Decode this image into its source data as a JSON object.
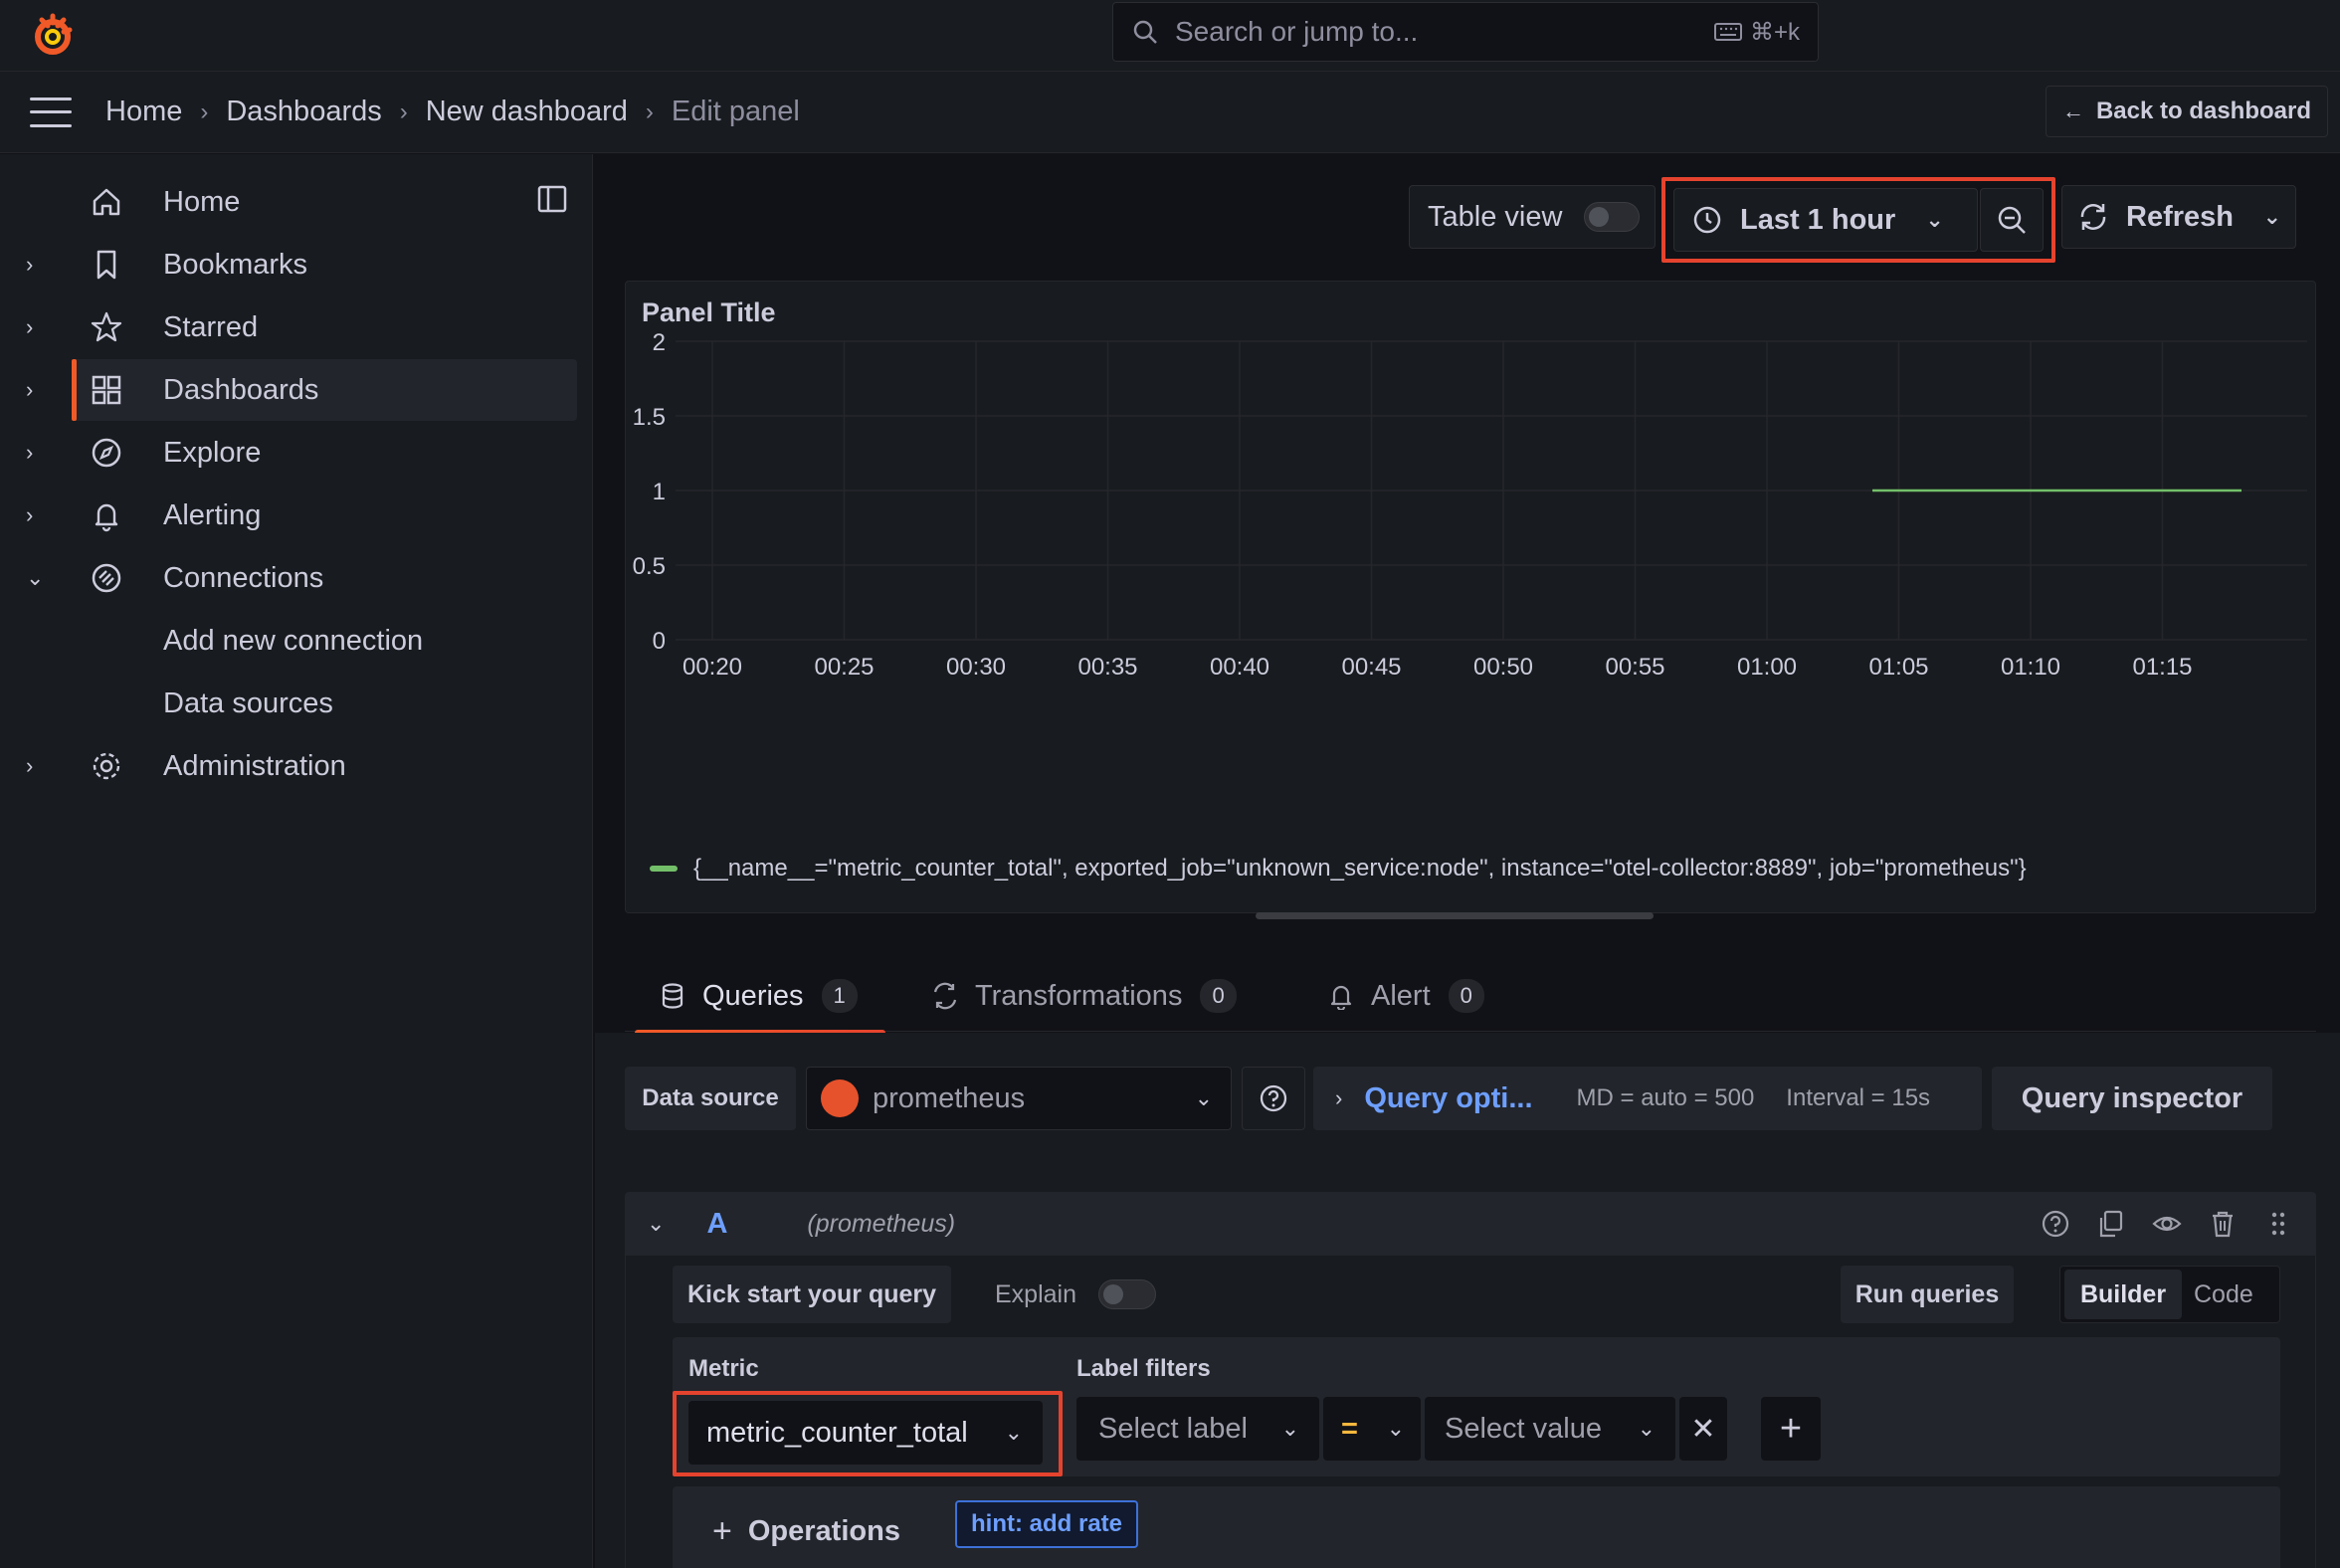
{
  "search": {
    "placeholder": "Search or jump to...",
    "shortcut": "⌘+k"
  },
  "breadcrumb": [
    "Home",
    "Dashboards",
    "New dashboard",
    "Edit panel"
  ],
  "back_label": "Back to dashboard",
  "sidebar": {
    "items": [
      {
        "label": "Home",
        "icon": "home-icon"
      },
      {
        "label": "Bookmarks",
        "icon": "bookmark-icon"
      },
      {
        "label": "Starred",
        "icon": "star-icon"
      },
      {
        "label": "Dashboards",
        "icon": "apps-icon",
        "active": true
      },
      {
        "label": "Explore",
        "icon": "compass-icon"
      },
      {
        "label": "Alerting",
        "icon": "bell-icon"
      },
      {
        "label": "Connections",
        "icon": "connections-icon",
        "expanded": true
      },
      {
        "label": "Add new connection"
      },
      {
        "label": "Data sources"
      },
      {
        "label": "Administration",
        "icon": "gear-icon"
      }
    ]
  },
  "toolbar": {
    "table_view": "Table view",
    "time_range": "Last 1 hour",
    "refresh": "Refresh"
  },
  "panel": {
    "title": "Panel Title"
  },
  "chart_data": {
    "type": "line",
    "title": "Panel Title",
    "x_ticks": [
      "00:20",
      "00:25",
      "00:30",
      "00:35",
      "00:40",
      "00:45",
      "00:50",
      "00:55",
      "01:00",
      "01:05",
      "01:10",
      "01:15"
    ],
    "y_ticks": [
      "0",
      "0.5",
      "1",
      "1.5",
      "2"
    ],
    "ylim": [
      0,
      2
    ],
    "series": [
      {
        "name": "{__name__=\"metric_counter_total\", exported_job=\"unknown_service:node\", instance=\"otel-collector:8889\", job=\"prometheus\"}",
        "color": "#73bf69",
        "x_start": "01:04",
        "x_end": "01:18",
        "value": 1
      }
    ],
    "grid": true,
    "legend": "bottom-left"
  },
  "tabs": [
    {
      "label": "Queries",
      "count": "1"
    },
    {
      "label": "Transformations",
      "count": "0"
    },
    {
      "label": "Alert",
      "count": "0"
    }
  ],
  "query_toolbar": {
    "data_source_label": "Data source",
    "data_source": "prometheus",
    "query_options": "Query opti...",
    "md": "MD = auto = 500",
    "interval": "Interval = 15s",
    "inspector": "Query inspector"
  },
  "query": {
    "ref": "A",
    "datasource": "(prometheus)",
    "kick_start": "Kick start your query",
    "explain": "Explain",
    "run": "Run queries",
    "mode_builder": "Builder",
    "mode_code": "Code",
    "metric_label": "Metric",
    "metric_value": "metric_counter_total",
    "filters_label": "Label filters",
    "select_label": "Select label",
    "operator": "=",
    "select_value": "Select value",
    "operations": "Operations",
    "hint": "hint: add rate"
  }
}
